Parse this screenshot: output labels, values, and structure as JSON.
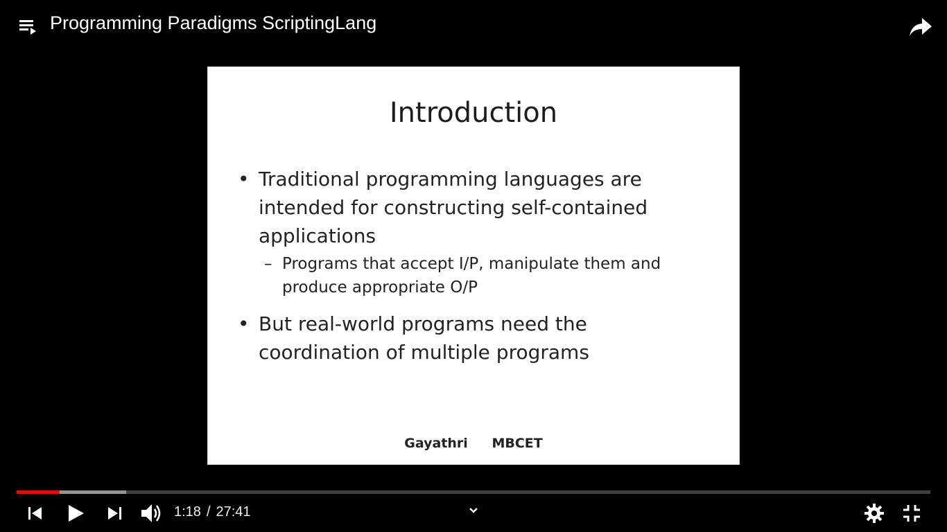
{
  "window": {
    "title": "Programming Paradigms ScriptingLang"
  },
  "slide": {
    "title": "Introduction",
    "bullets": [
      {
        "marker": "•",
        "text_lines": [
          "Traditional programming languages are",
          "intended for constructing self-contained",
          "applications"
        ]
      },
      {
        "marker": "•",
        "text_lines": [
          "But real-world programs need the",
          "coordination of multiple programs"
        ]
      }
    ],
    "sub_bullet": {
      "marker": "–",
      "text_lines": [
        "Programs that accept I/P, manipulate them and",
        "produce appropriate O/P"
      ]
    },
    "footer": {
      "author": "Gayathri",
      "institution": "MBCET"
    }
  },
  "player": {
    "current_time": "1:18",
    "separator": "/",
    "duration": "27:41",
    "played_fraction": 0.047,
    "buffered_fraction": 0.12,
    "accent_color": "#ff0000"
  },
  "icons": {
    "playlist": "playlist-icon",
    "share": "share-icon",
    "previous": "previous-icon",
    "play": "play-icon",
    "next": "next-icon",
    "volume": "volume-icon",
    "chevron": "chevron-down-icon",
    "settings": "gear-icon",
    "exit_fullscreen": "exit-fullscreen-icon"
  }
}
